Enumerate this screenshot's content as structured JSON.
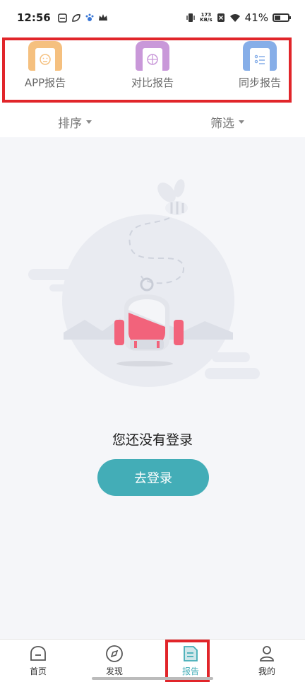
{
  "status_bar": {
    "time": "12:56",
    "net_speed_value": "173",
    "net_speed_unit": "KB/s",
    "battery": "41%",
    "battery_level": 0.41
  },
  "report_tabs": [
    {
      "label": "APP报告",
      "icon": "face-neutral-icon",
      "color": "#f5c07f"
    },
    {
      "label": "对比报告",
      "icon": "crosshair-icon",
      "color": "#c998d9"
    },
    {
      "label": "同步报告",
      "icon": "list-icon",
      "color": "#86aee8"
    }
  ],
  "filters": {
    "sort_label": "排序",
    "filter_label": "筛选"
  },
  "empty_state": {
    "title": "您还没有登录",
    "login_button": "去登录"
  },
  "bottom_nav": [
    {
      "label": "首页",
      "icon": "home-icon"
    },
    {
      "label": "发现",
      "icon": "compass-icon"
    },
    {
      "label": "报告",
      "icon": "report-icon",
      "active": true
    },
    {
      "label": "我的",
      "icon": "profile-icon"
    }
  ],
  "colors": {
    "accent": "#43adb7",
    "highlight_outline": "#e1252a"
  }
}
